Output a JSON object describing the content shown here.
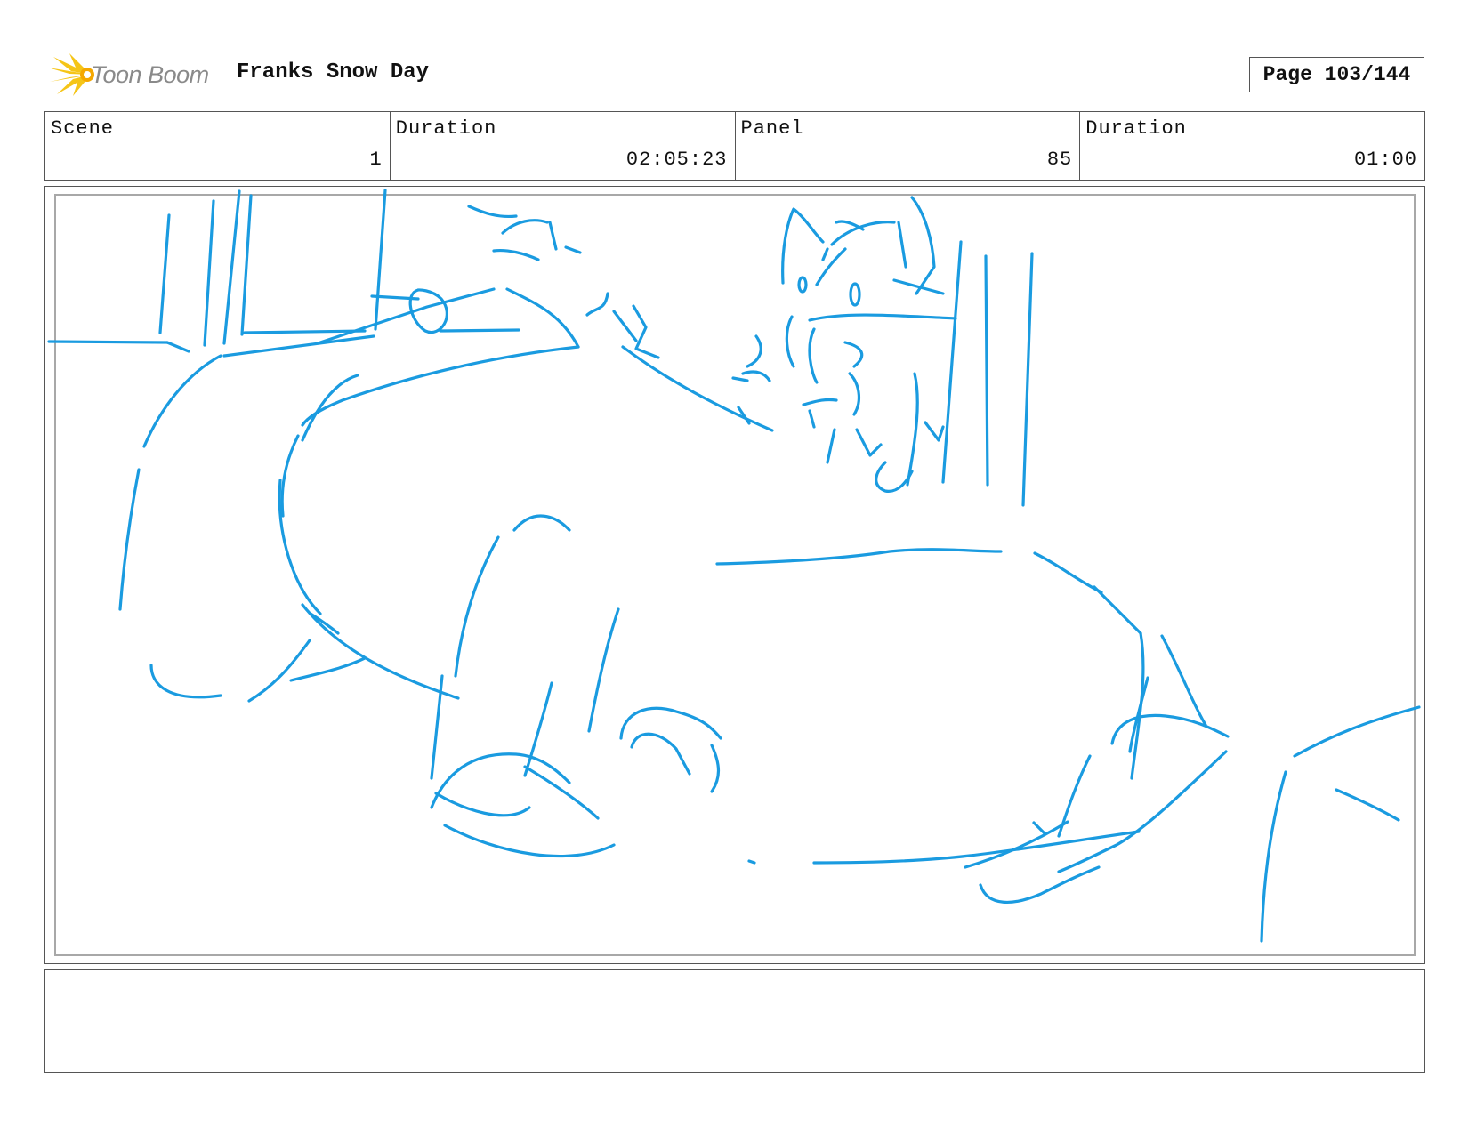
{
  "header": {
    "logo_text": "Toon Boom",
    "title": "Franks Snow Day",
    "page": "Page 103/144"
  },
  "info": {
    "scene_label": "Scene",
    "scene_value": "1",
    "scene_duration_label": "Duration",
    "scene_duration_value": "02:05:23",
    "panel_label": "Panel",
    "panel_value": "85",
    "panel_duration_label": "Duration",
    "panel_duration_value": "01:00"
  },
  "notes": {
    "text": ""
  },
  "colors": {
    "sketch_stroke": "#1a9be0",
    "logo_yellow": "#f5c518",
    "logo_text": "#8a8a8a"
  }
}
